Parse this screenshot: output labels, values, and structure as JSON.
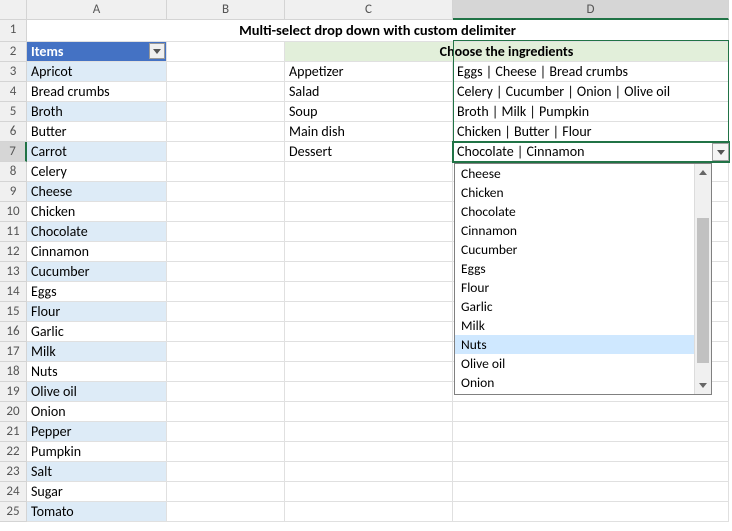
{
  "columns": [
    "A",
    "B",
    "C",
    "D"
  ],
  "row_count": 25,
  "title": "Multi-select drop down with custom delimiter",
  "items_header": "Items",
  "ingredients_header": "Choose the ingredients",
  "items": [
    "Apricot",
    "Bread crumbs",
    "Broth",
    "Butter",
    "Carrot",
    "Celery",
    "Cheese",
    "Chicken",
    "Chocolate",
    "Cinnamon",
    "Cucumber",
    "Eggs",
    "Flour",
    "Garlic",
    "Milk",
    "Nuts",
    "Olive oil",
    "Onion",
    "Pepper",
    "Pumpkin",
    "Salt",
    "Sugar",
    "Tomato"
  ],
  "courses": [
    {
      "name": "Appetizer",
      "ingredients": "Eggs | Cheese | Bread crumbs"
    },
    {
      "name": "Salad",
      "ingredients": "Celery | Cucumber | Onion | Olive oil"
    },
    {
      "name": "Soup",
      "ingredients": "Broth | Milk | Pumpkin"
    },
    {
      "name": "Main dish",
      "ingredients": "Chicken | Butter | Flour"
    },
    {
      "name": "Dessert",
      "ingredients": "Chocolate | Cinnamon"
    }
  ],
  "dropdown": {
    "options": [
      "Cheese",
      "Chicken",
      "Chocolate",
      "Cinnamon",
      "Cucumber",
      "Eggs",
      "Flour",
      "Garlic",
      "Milk",
      "Nuts",
      "Olive oil",
      "Onion"
    ],
    "hover_index": 9
  },
  "selected_row": 7,
  "selected_col": "D"
}
